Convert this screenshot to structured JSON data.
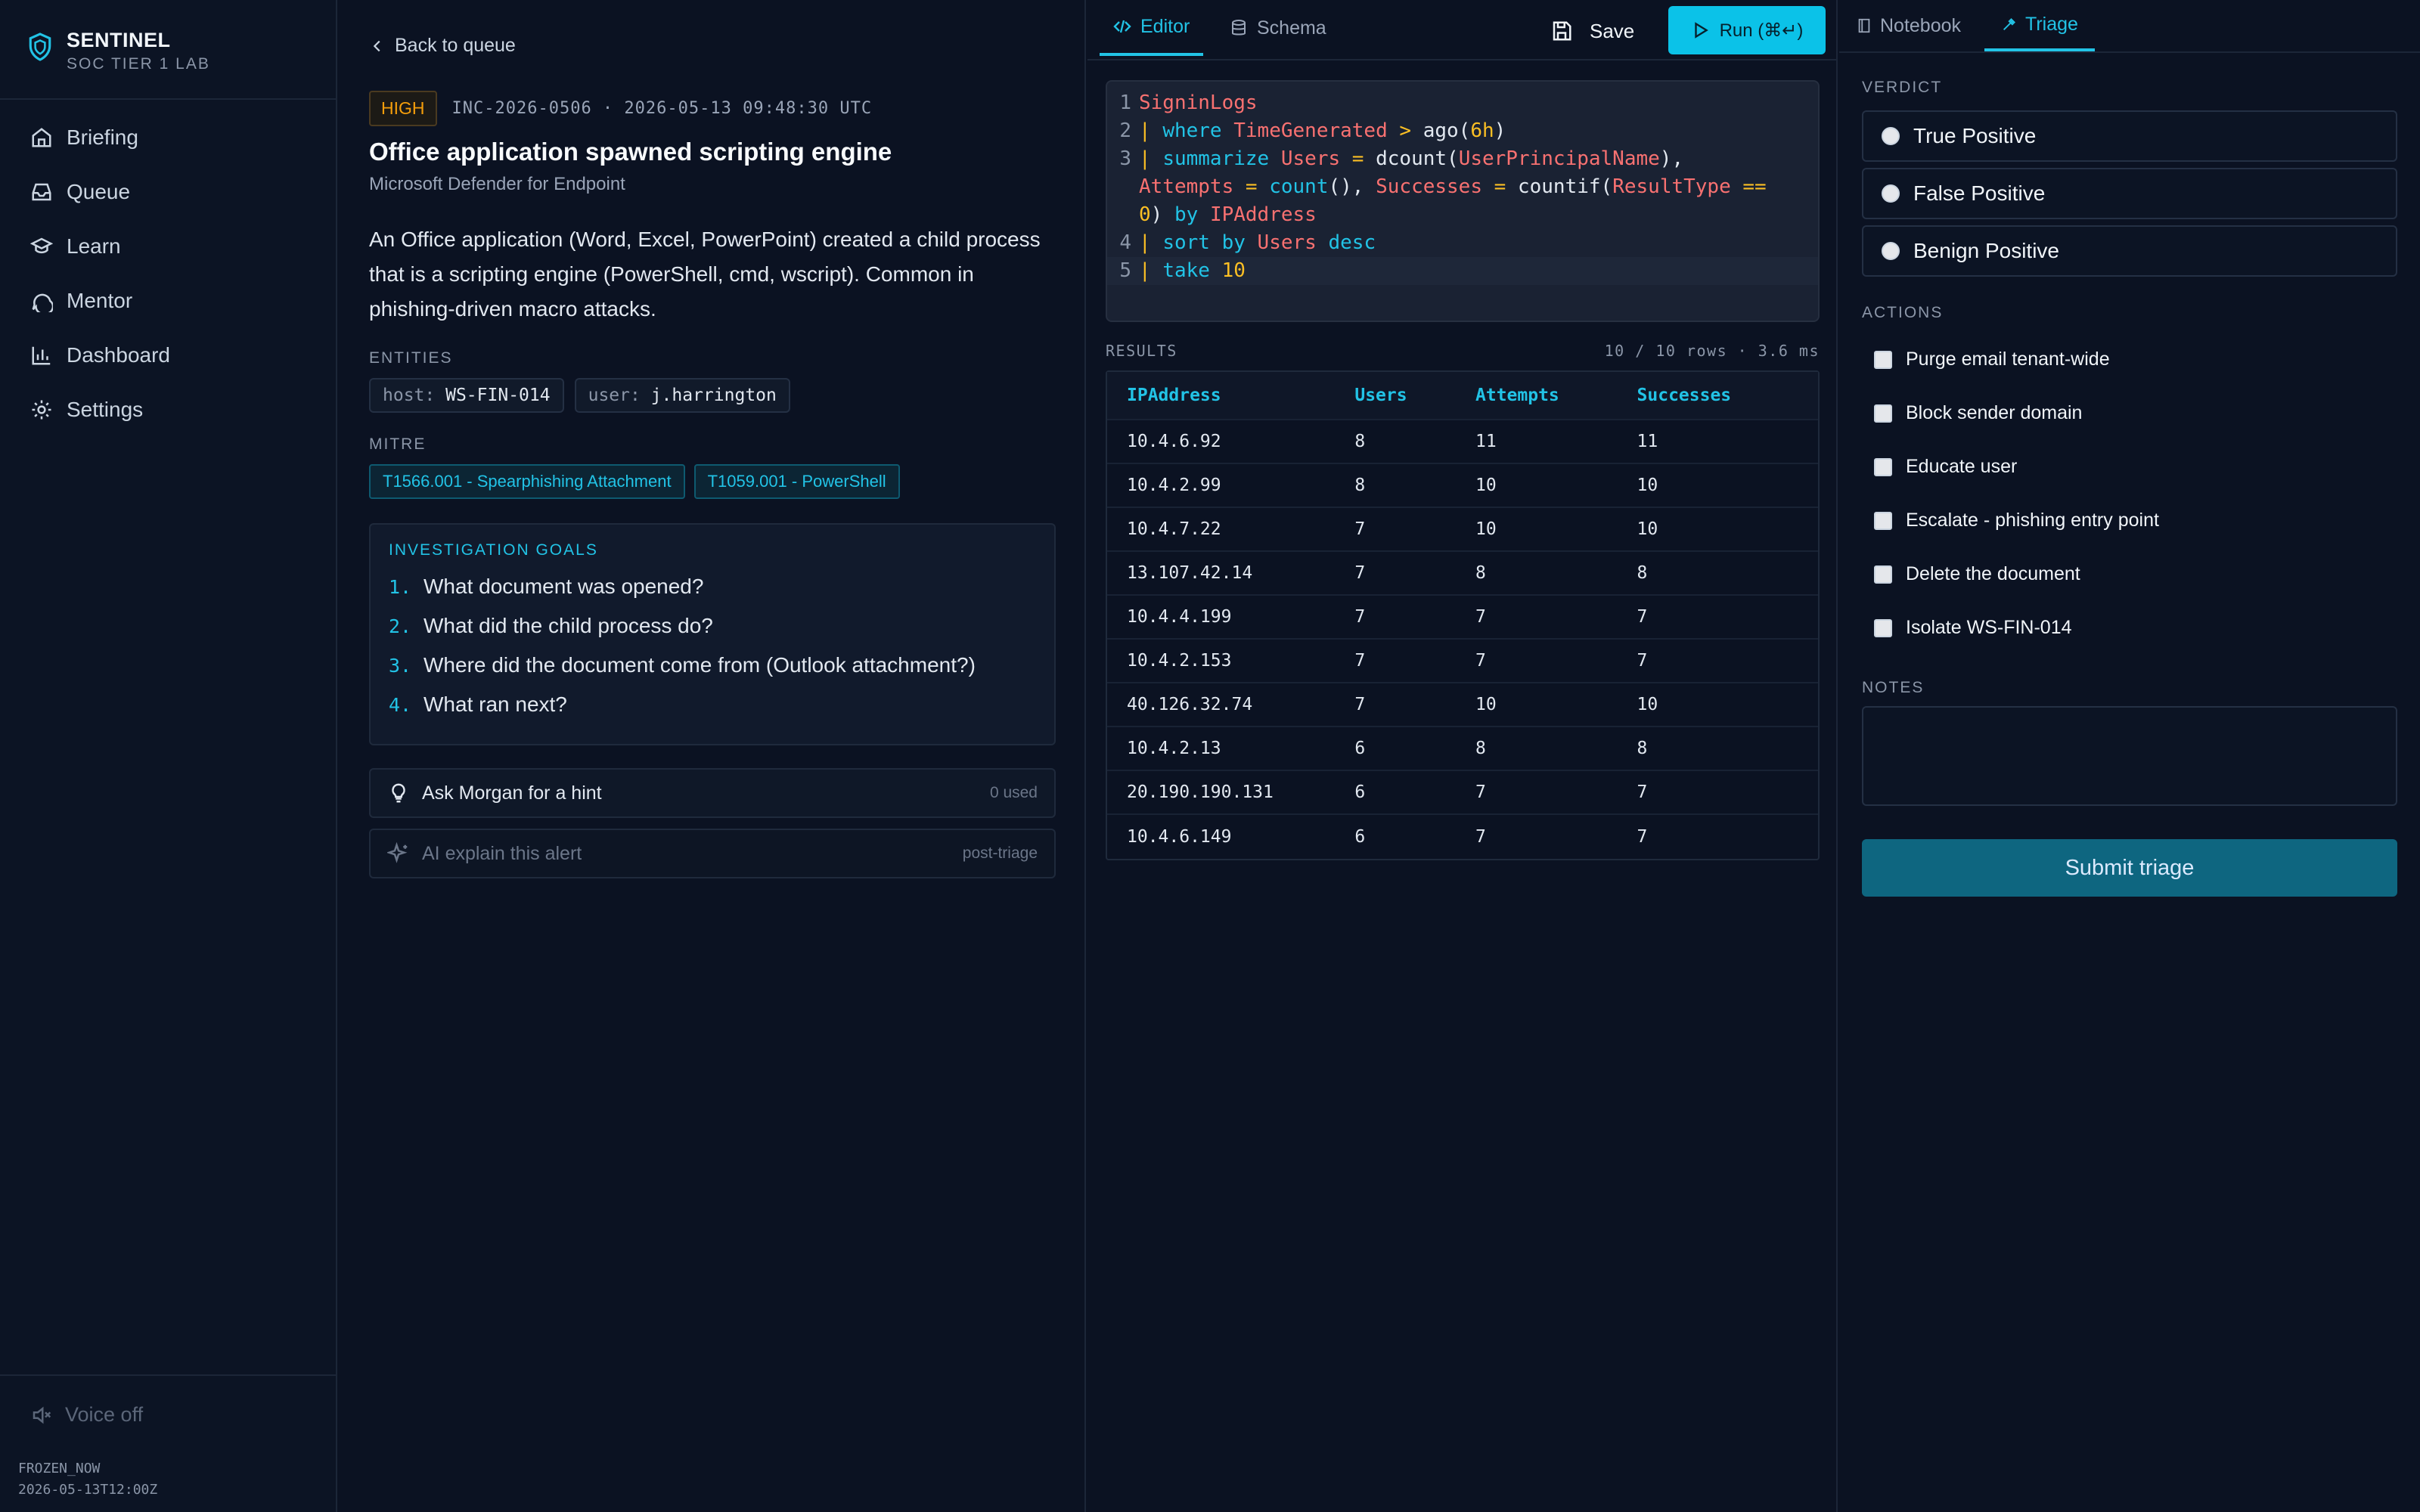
{
  "brand": {
    "title": "SENTINEL",
    "subtitle": "SOC TIER 1 LAB"
  },
  "sidebar": {
    "items": [
      {
        "label": "Briefing",
        "icon": "home-icon"
      },
      {
        "label": "Queue",
        "icon": "inbox-icon"
      },
      {
        "label": "Learn",
        "icon": "graduation-cap-icon"
      },
      {
        "label": "Mentor",
        "icon": "message-circle-icon"
      },
      {
        "label": "Dashboard",
        "icon": "bar-chart-icon"
      },
      {
        "label": "Settings",
        "icon": "gear-icon"
      }
    ],
    "voice_label": "Voice off",
    "frozen_label": "FROZEN_NOW",
    "frozen_value": "2026-05-13T12:00Z"
  },
  "incident": {
    "back_label": "Back to queue",
    "severity": "HIGH",
    "id_and_time": "INC-2026-0506 · 2026-05-13 09:48:30 UTC",
    "title": "Office application spawned scripting engine",
    "source": "Microsoft Defender for Endpoint",
    "description": "An Office application (Word, Excel, PowerPoint) created a child process that is a scripting engine (PowerShell, cmd, wscript). Common in phishing-driven macro attacks.",
    "entities_label": "ENTITIES",
    "entities": [
      {
        "key": "host:",
        "value": "WS-FIN-014"
      },
      {
        "key": "user:",
        "value": "j.harrington"
      }
    ],
    "mitre_label": "MITRE",
    "mitre": [
      "T1566.001 - Spearphishing Attachment",
      "T1059.001 - PowerShell"
    ],
    "goals_title": "INVESTIGATION GOALS",
    "goals": [
      {
        "n": "1.",
        "text": "What document was opened?"
      },
      {
        "n": "2.",
        "text": "What did the child process do?"
      },
      {
        "n": "3.",
        "text": "Where did the document come from (Outlook attachment?)"
      },
      {
        "n": "4.",
        "text": "What ran next?"
      }
    ],
    "hint_label": "Ask Morgan for a hint",
    "hint_count": "0 used",
    "ai_label": "AI explain this alert",
    "ai_note": "post-triage"
  },
  "editor": {
    "tabs": [
      "Editor",
      "Schema"
    ],
    "save_label": "Save",
    "run_label": "Run (⌘↵)",
    "line_numbers": [
      "1",
      "2",
      "3",
      "4",
      "5"
    ],
    "query_lines": [
      "SigninLogs",
      "| where TimeGenerated > ago(6h)",
      "| summarize Users = dcount(UserPrincipalName), Attempts = count(), Successes = countif(ResultType == 0) by IPAddress",
      "| sort by Users desc",
      "| take 10"
    ],
    "results_label": "RESULTS",
    "results_meta": "10 / 10 rows · 3.6 ms",
    "columns": [
      "IPAddress",
      "Users",
      "Attempts",
      "Successes"
    ],
    "rows": [
      [
        "10.4.6.92",
        "8",
        "11",
        "11"
      ],
      [
        "10.4.2.99",
        "8",
        "10",
        "10"
      ],
      [
        "10.4.7.22",
        "7",
        "10",
        "10"
      ],
      [
        "13.107.42.14",
        "7",
        "8",
        "8"
      ],
      [
        "10.4.4.199",
        "7",
        "7",
        "7"
      ],
      [
        "10.4.2.153",
        "7",
        "7",
        "7"
      ],
      [
        "40.126.32.74",
        "7",
        "10",
        "10"
      ],
      [
        "10.4.2.13",
        "6",
        "8",
        "8"
      ],
      [
        "20.190.190.131",
        "6",
        "7",
        "7"
      ],
      [
        "10.4.6.149",
        "6",
        "7",
        "7"
      ]
    ]
  },
  "triage": {
    "tabs": [
      "Notebook",
      "Triage"
    ],
    "verdict_label": "VERDICT",
    "verdicts": [
      "True Positive",
      "False Positive",
      "Benign Positive"
    ],
    "actions_label": "ACTIONS",
    "actions": [
      "Purge email tenant-wide",
      "Block sender domain",
      "Educate user",
      "Escalate - phishing entry point",
      "Delete the document",
      "Isolate WS-FIN-014"
    ],
    "notes_label": "NOTES",
    "notes_value": "",
    "submit_label": "Submit triage"
  },
  "colors": {
    "accent": "#22c3e6",
    "severity_high": "#f59e0b",
    "background": "#0b1222"
  }
}
